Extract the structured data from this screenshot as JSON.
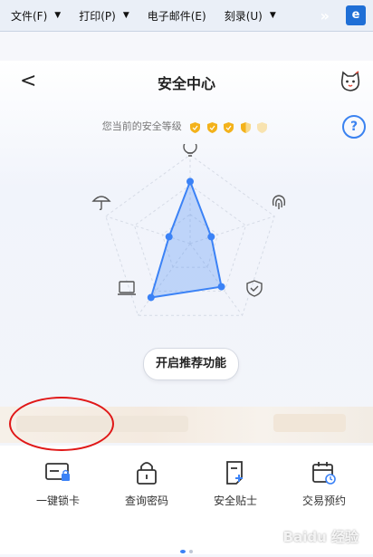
{
  "menubar": {
    "items": [
      {
        "label": "文件(F)"
      },
      {
        "label": "打印(P)"
      },
      {
        "label": "电子邮件(E)"
      },
      {
        "label": "刻录(U)"
      }
    ],
    "extra": "»",
    "ext_label": "e"
  },
  "header": {
    "back": "<",
    "title": "安全中心"
  },
  "security": {
    "level_label": "您当前的安全等级",
    "shields_full": 4,
    "shields_total": 5,
    "help": "?"
  },
  "radar": {
    "axes": [
      "bulb",
      "fingerprint",
      "shield",
      "device",
      "umbrella"
    ],
    "values": [
      0.7,
      0.25,
      0.6,
      0.75,
      0.25
    ],
    "color": "#3b82f6"
  },
  "cta": {
    "label": "开启推荐功能"
  },
  "quick_actions": [
    {
      "label": "一键锁卡",
      "icon": "card-lock-icon"
    },
    {
      "label": "查询密码",
      "icon": "padlock-icon"
    },
    {
      "label": "安全贴士",
      "icon": "document-plus-icon"
    },
    {
      "label": "交易预约",
      "icon": "calendar-clock-icon"
    }
  ],
  "pager": {
    "count": 2,
    "active": 0
  },
  "watermark": "Baidu 经验",
  "colors": {
    "accent": "#3b82f6",
    "gold": "#f3b21b",
    "annotation": "#e01818"
  }
}
